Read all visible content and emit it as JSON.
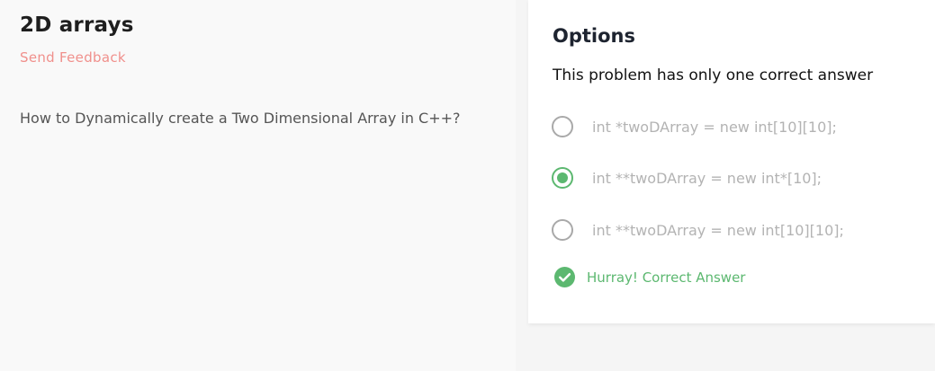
{
  "problem": {
    "title": "2D arrays",
    "feedback_label": "Send Feedback",
    "question": "How to Dynamically create a Two Dimensional Array in C++?"
  },
  "options_panel": {
    "title": "Options",
    "subtitle": "This problem has only one correct answer",
    "options": [
      {
        "label": "int *twoDArray = new int[10][10];",
        "selected": false
      },
      {
        "label": "int **twoDArray = new int*[10];",
        "selected": true
      },
      {
        "label": "int **twoDArray = new int[10][10];",
        "selected": false
      }
    ],
    "result": {
      "icon": "check-circle-icon",
      "text": "Hurray! Correct Answer"
    }
  },
  "colors": {
    "accent_green": "#5cb870",
    "feedback_pink": "#f0908c",
    "option_text_gray": "#b3b3b3"
  }
}
